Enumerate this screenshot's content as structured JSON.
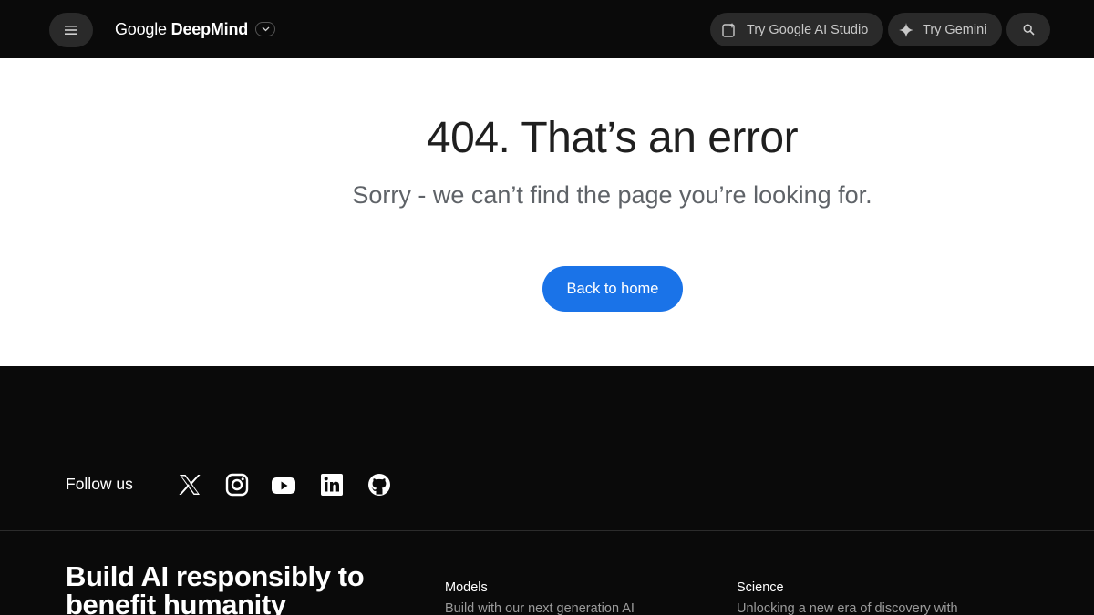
{
  "header": {
    "brand_prefix": "Google",
    "brand_name": "DeepMind",
    "menu_icon": "hamburger-menu-icon",
    "try_studio_label": "Try Google AI Studio",
    "try_gemini_label": "Try Gemini",
    "search_icon": "search-icon"
  },
  "error": {
    "title": "404. That’s an error",
    "subtitle": "Sorry - we can’t find the page you’re looking for.",
    "button_label": "Back to home"
  },
  "footer": {
    "follow_label": "Follow us",
    "social": [
      "x-icon",
      "instagram-icon",
      "youtube-icon",
      "linkedin-icon",
      "github-icon"
    ],
    "tagline": "Build AI responsibly to benefit humanity",
    "columns": [
      {
        "title": "Models",
        "description": "Build with our next generation AI"
      },
      {
        "title": "Science",
        "description": "Unlocking a new era of discovery with"
      }
    ]
  },
  "colors": {
    "dark_bg": "#0a0a0a",
    "pill_bg": "#2a2a2a",
    "primary_button": "#1a73e8",
    "title_text": "#1f1f1f",
    "subtitle_text": "#5f6368"
  }
}
